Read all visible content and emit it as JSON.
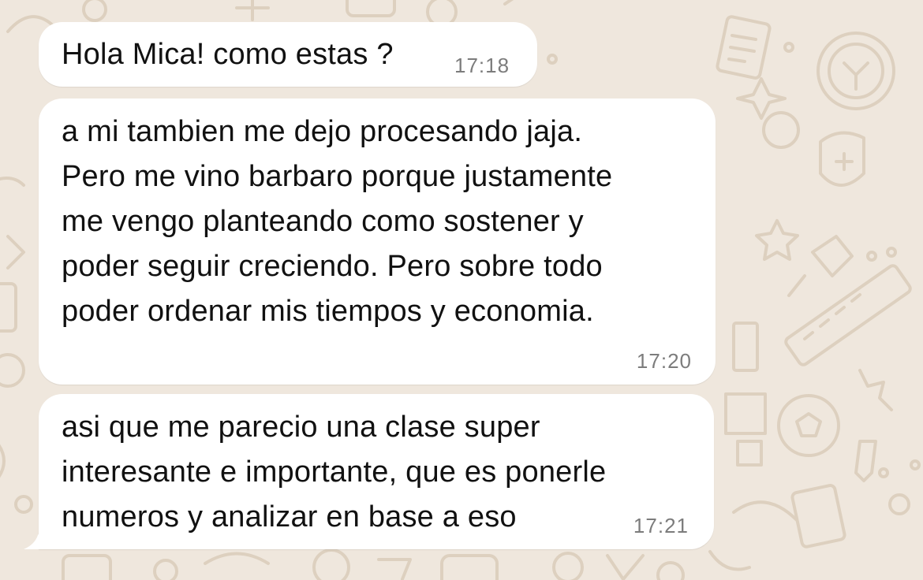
{
  "chat": {
    "messages": [
      {
        "text": "Hola Mica! como estas ?",
        "time": "17:18"
      },
      {
        "text": "a mi tambien me dejo procesando jaja.\nPero me vino barbaro porque justamente\nme vengo planteando como sostener y\npoder seguir creciendo. Pero sobre todo\npoder ordenar mis tiempos y economia.",
        "time": "17:20"
      },
      {
        "text": "asi que me parecio una clase super\ninteresante e importante, que es ponerle\nnumeros y analizar en base a eso",
        "time": "17:21"
      }
    ]
  },
  "theme": {
    "background": "#efe7dd",
    "doodle": "#ddd0bf",
    "bubble": "#ffffff",
    "text": "#111111",
    "timestamp": "#7c7c7c"
  }
}
